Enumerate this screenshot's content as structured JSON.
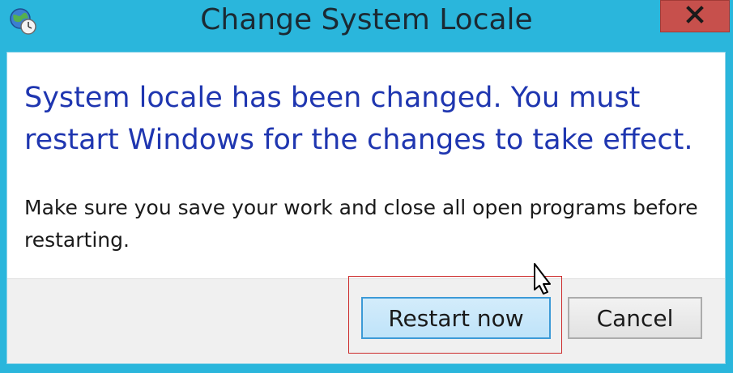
{
  "dialog": {
    "title": "Change System Locale",
    "close_label": "X",
    "main_instruction": "System locale has been changed. You must restart Windows for the changes to take effect.",
    "content": "Make sure you save your work and close all open programs before restarting.",
    "buttons": {
      "restart": "Restart now",
      "cancel": "Cancel"
    }
  },
  "icons": {
    "app": "globe-clock-icon",
    "close": "close-icon",
    "cursor": "mouse-pointer-icon"
  },
  "colors": {
    "frame": "#2ab6dc",
    "close": "#c7504c",
    "instruction": "#1f36b0",
    "highlight": "#cc2a2a",
    "primary_button_border": "#3c9ad7"
  }
}
